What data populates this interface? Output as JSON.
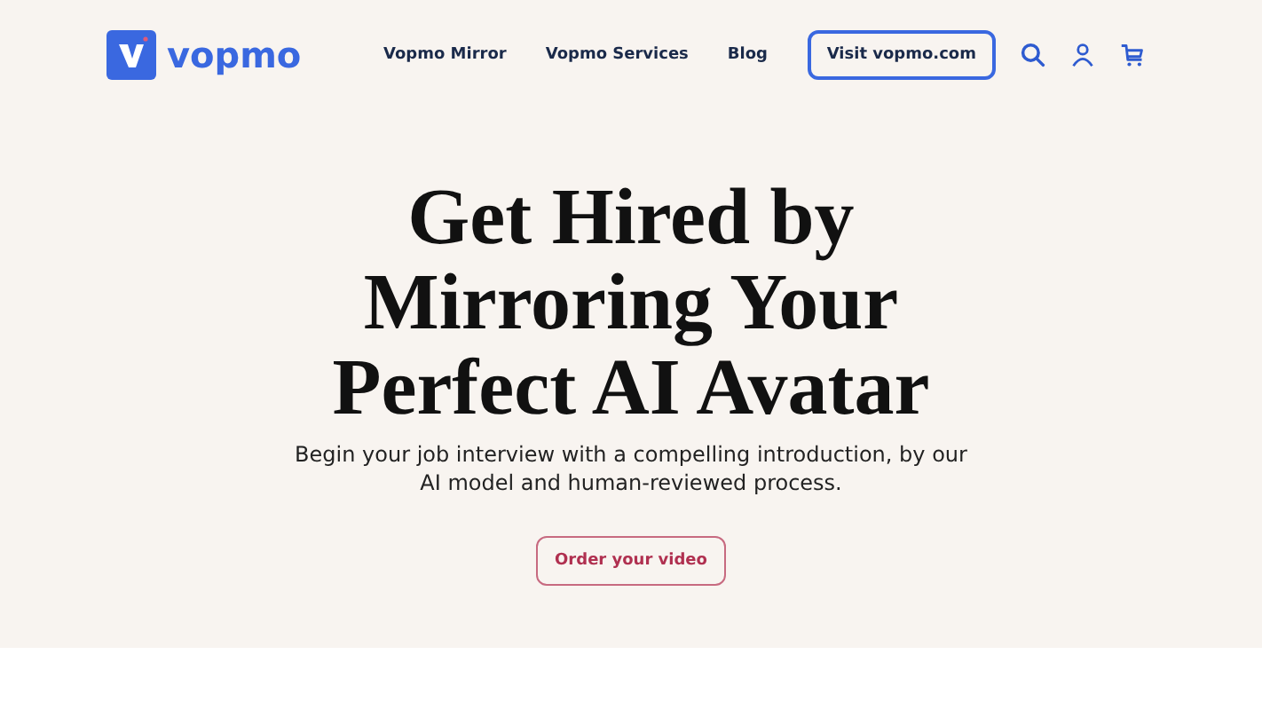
{
  "header": {
    "logo": "vopmo",
    "nav": [
      {
        "label": "Vopmo Mirror"
      },
      {
        "label": "Vopmo Services"
      },
      {
        "label": "Blog"
      }
    ],
    "cta": "Visit vopmo.com"
  },
  "hero": {
    "title_lines": [
      "Get Hired by",
      "Mirroring Your",
      "Perfect AI Avatar"
    ],
    "subtitle": "Begin your job interview with a compelling introduction, by our AI model and human-reviewed process.",
    "button": "Order your video"
  }
}
